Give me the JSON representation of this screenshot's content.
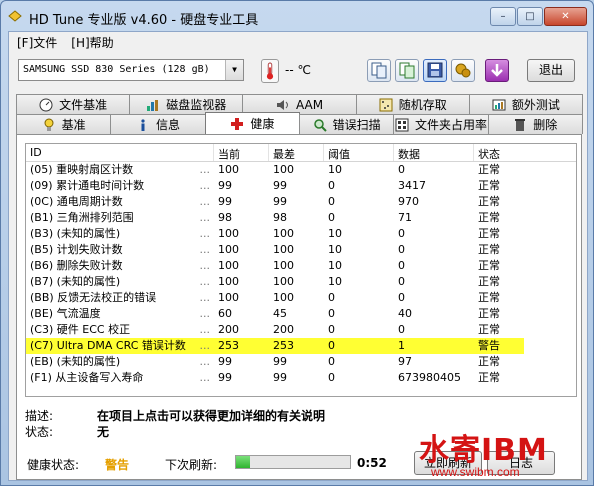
{
  "window": {
    "title": "HD Tune 专业版 v4.60 - 硬盘专业工具",
    "controls": {
      "minimize": "–",
      "maximize": "□",
      "close": "✕"
    }
  },
  "menu": [
    {
      "label": "[F]文件"
    },
    {
      "label": "[H]帮助"
    }
  ],
  "toolbar": {
    "disk": "SAMSUNG SSD 830 Series (128 gB)",
    "temperature": "-- ℃",
    "exit_label": "退出",
    "icons": [
      "copy-text-icon",
      "copy-screen-icon",
      "save-icon",
      "options-icon",
      "download-icon"
    ]
  },
  "tabs": {
    "row1": [
      {
        "label": "文件基准",
        "icon": "file-benchmark-icon"
      },
      {
        "label": "磁盘监视器",
        "icon": "disk-monitor-icon"
      },
      {
        "label": "AAM",
        "icon": "speaker-icon"
      },
      {
        "label": "随机存取",
        "icon": "random-access-icon"
      },
      {
        "label": "额外测试",
        "icon": "extra-tests-icon"
      }
    ],
    "row2": [
      {
        "label": "基准",
        "icon": "benchmark-icon"
      },
      {
        "label": "信息",
        "icon": "info-icon"
      },
      {
        "label": "健康",
        "icon": "health-icon",
        "active": true
      },
      {
        "label": "错误扫描",
        "icon": "error-scan-icon"
      },
      {
        "label": "文件夹占用率",
        "icon": "folder-usage-icon"
      },
      {
        "label": "删除",
        "icon": "erase-icon"
      }
    ]
  },
  "smart": {
    "columns": [
      "ID",
      "当前",
      "最差",
      "阈值",
      "数据",
      "状态"
    ],
    "rows": [
      {
        "id": "(05) 重映射扇区计数",
        "current": "100",
        "worst": "100",
        "threshold": "10",
        "data": "0",
        "status": "正常"
      },
      {
        "id": "(09) 累计通电时间计数",
        "current": "99",
        "worst": "99",
        "threshold": "0",
        "data": "3417",
        "status": "正常"
      },
      {
        "id": "(0C) 通电周期计数",
        "current": "99",
        "worst": "99",
        "threshold": "0",
        "data": "970",
        "status": "正常"
      },
      {
        "id": "(B1) 三角洲排列范围",
        "current": "98",
        "worst": "98",
        "threshold": "0",
        "data": "71",
        "status": "正常"
      },
      {
        "id": "(B3) (未知的属性)",
        "current": "100",
        "worst": "100",
        "threshold": "10",
        "data": "0",
        "status": "正常"
      },
      {
        "id": "(B5) 计划失败计数",
        "current": "100",
        "worst": "100",
        "threshold": "10",
        "data": "0",
        "status": "正常"
      },
      {
        "id": "(B6) 删除失败计数",
        "current": "100",
        "worst": "100",
        "threshold": "10",
        "data": "0",
        "status": "正常"
      },
      {
        "id": "(B7) (未知的属性)",
        "current": "100",
        "worst": "100",
        "threshold": "10",
        "data": "0",
        "status": "正常"
      },
      {
        "id": "(BB) 反馈无法校正的错误",
        "current": "100",
        "worst": "100",
        "threshold": "0",
        "data": "0",
        "status": "正常"
      },
      {
        "id": "(BE) 气流温度",
        "current": "60",
        "worst": "45",
        "threshold": "0",
        "data": "40",
        "status": "正常"
      },
      {
        "id": "(C3) 硬件 ECC 校正",
        "current": "200",
        "worst": "200",
        "threshold": "0",
        "data": "0",
        "status": "正常"
      },
      {
        "id": "(C7) Ultra DMA CRC 错误计数",
        "current": "253",
        "worst": "253",
        "threshold": "0",
        "data": "1",
        "status": "警告",
        "warning": true
      },
      {
        "id": "(EB) (未知的属性)",
        "current": "99",
        "worst": "99",
        "threshold": "0",
        "data": "97",
        "status": "正常"
      },
      {
        "id": "(F1) 从主设备写入寿命",
        "current": "99",
        "worst": "99",
        "threshold": "0",
        "data": "673980405",
        "status": "正常"
      }
    ]
  },
  "description": {
    "desc_label": "描述:",
    "desc_value": "在项目上点击可以获得更加详细的有关说明",
    "state_label": "状态:",
    "state_value": "无"
  },
  "status": {
    "health_label": "健康状态:",
    "health_value": "警告",
    "next_refresh_label": "下次刷新:",
    "next_refresh_time": "0:52",
    "refresh_progress": 0.12,
    "refresh_button": "立即刷新",
    "log_button": "日志"
  },
  "watermark": {
    "logo": "水寄IBM",
    "url": "www.swibm.com"
  }
}
